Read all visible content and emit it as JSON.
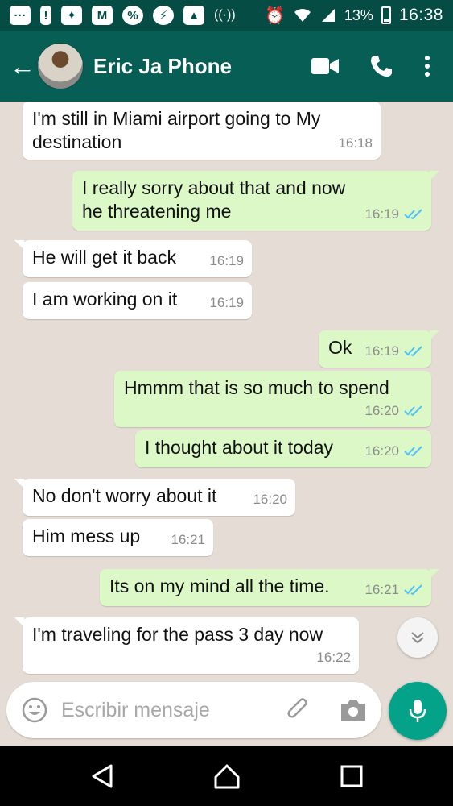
{
  "status_bar": {
    "battery_percent": "13%",
    "time": "16:38",
    "icons": [
      "more-icon",
      "alert-icon",
      "app-icon",
      "gmail-icon",
      "percent-icon",
      "messenger-icon",
      "gallery-icon",
      "hotspot-icon",
      "alarm-icon",
      "wifi-icon",
      "signal-icon",
      "battery-icon"
    ]
  },
  "header": {
    "contact_name": "Eric Ja Phone",
    "icons": [
      "back-arrow-icon",
      "avatar",
      "video-call-icon",
      "phone-call-icon",
      "more-vert-icon"
    ]
  },
  "messages": [
    {
      "dir": "in",
      "text": "I'm still in Miami airport going to My destination",
      "time": "16:18"
    },
    {
      "dir": "out",
      "text": "I really sorry about that and now he threatening me",
      "time": "16:19",
      "status": "read"
    },
    {
      "dir": "in",
      "text": "He will get it back",
      "time": "16:19"
    },
    {
      "dir": "in",
      "text": "I am working on it",
      "time": "16:19"
    },
    {
      "dir": "out",
      "text": "Ok",
      "time": "16:19",
      "status": "read"
    },
    {
      "dir": "out",
      "text": "Hmmm that is so much to spend",
      "time": "16:20",
      "status": "read"
    },
    {
      "dir": "out",
      "text": "I thought about it today",
      "time": "16:20",
      "status": "read"
    },
    {
      "dir": "in",
      "text": "No don't worry about it",
      "time": "16:20"
    },
    {
      "dir": "in",
      "text": "Him mess up",
      "time": "16:21"
    },
    {
      "dir": "out",
      "text": "Its on my mind all the time.",
      "time": "16:21",
      "status": "read"
    },
    {
      "dir": "in",
      "text": "I'm traveling for the pass 3 day now",
      "time": "16:22"
    }
  ],
  "composer": {
    "placeholder": "Escribir mensaje",
    "icons": [
      "emoji-icon",
      "attach-icon",
      "camera-icon",
      "mic-icon"
    ]
  },
  "colors": {
    "status_bar": "#054d44",
    "header": "#075e54",
    "chat_bg": "#e5ddd5",
    "outgoing_bubble": "#dcf8c6",
    "incoming_bubble": "#ffffff",
    "read_ticks": "#4fc3f7",
    "mic_button": "#05a28a"
  }
}
